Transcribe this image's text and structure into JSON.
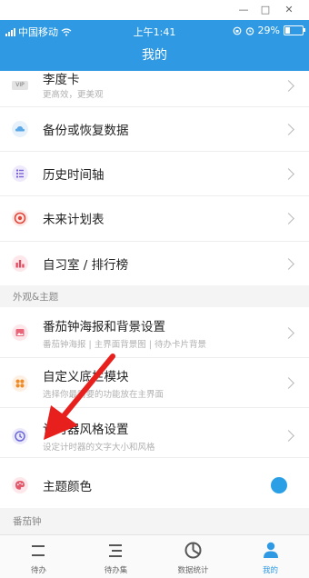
{
  "status": {
    "carrier": "中国移动",
    "time": "上午1:41",
    "battery": "29%"
  },
  "header": {
    "title": "我的"
  },
  "rows": [
    {
      "title": "李度卡",
      "subtitle": "更高效，更美观",
      "icon": "vip-icon"
    },
    {
      "title": "备份或恢复数据",
      "icon": "cloud-icon"
    },
    {
      "title": "历史时间轴",
      "icon": "timeline-icon"
    },
    {
      "title": "未来计划表",
      "icon": "target-icon"
    },
    {
      "title": "自习室 / 排行榜",
      "icon": "bar-chart-icon"
    }
  ],
  "sections": {
    "appearance": "外观&主题",
    "pomodoro": "番茄钟"
  },
  "appearance_rows": [
    {
      "title": "番茄钟海报和背景设置",
      "subtitle": "番茄钟海报 | 主界面背景图 | 待办卡片背景",
      "icon": "image-icon"
    },
    {
      "title": "自定义底栏模块",
      "subtitle": "选择你最需要的功能放在主界面",
      "icon": "modules-icon"
    },
    {
      "title": "计时器风格设置",
      "subtitle": "设定计时器的文字大小和风格",
      "icon": "clock-icon"
    },
    {
      "title": "主题颜色",
      "icon": "palette-icon"
    }
  ],
  "colors": {
    "accent": "#2f9ae3",
    "theme_swatch": "#2a9fe6",
    "arrow": "#e8201d"
  },
  "tabs": [
    {
      "label": "待办",
      "icon": "todo-icon"
    },
    {
      "label": "待办集",
      "icon": "todo-set-icon"
    },
    {
      "label": "数据统计",
      "icon": "pie-chart-icon"
    },
    {
      "label": "我的",
      "icon": "person-icon",
      "active": true
    }
  ]
}
